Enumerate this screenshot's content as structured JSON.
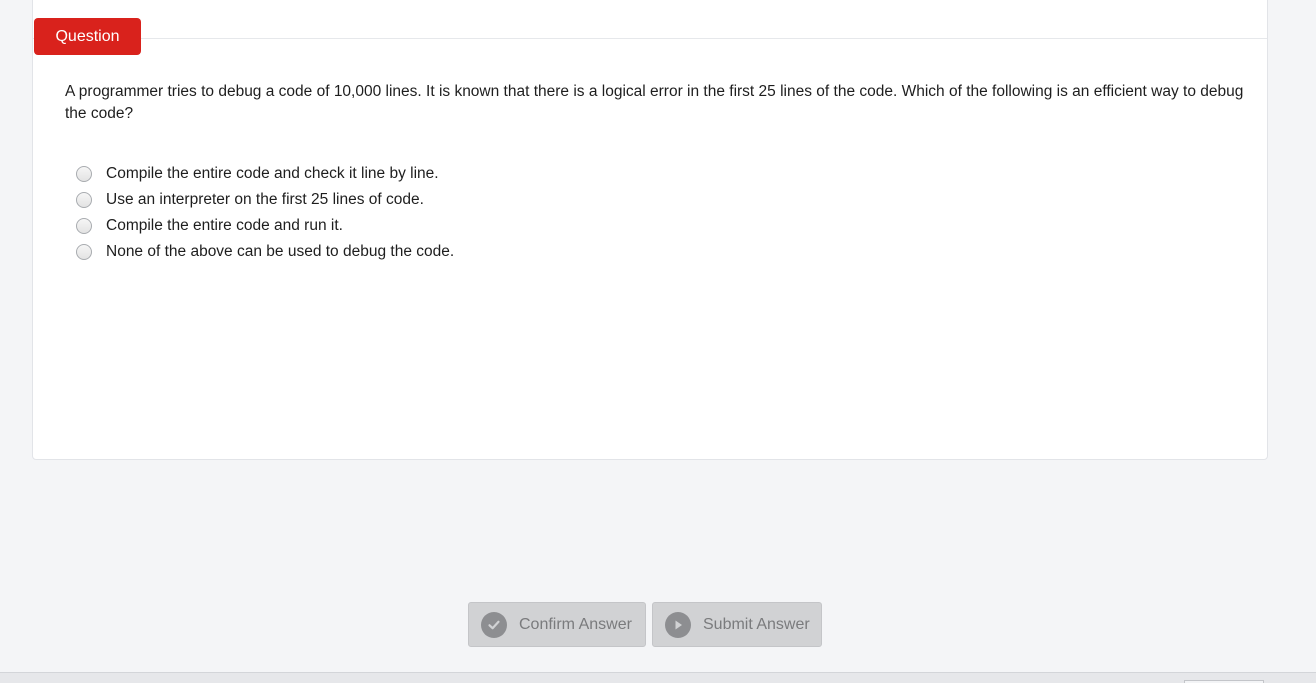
{
  "question": {
    "tag_label": "Question",
    "text": "A programmer tries to debug a code of 10,000 lines. It is known that there is a logical error in the first 25 lines of the code. Which of the following is an efficient way to debug the code?",
    "options": [
      "Compile the entire code and check it line by line.",
      "Use an interpreter on the first 25 lines of code.",
      "Compile the entire code and run it.",
      "None of the above can be used to debug the code."
    ]
  },
  "actions": {
    "confirm_label": "Confirm Answer",
    "submit_label": "Submit Answer",
    "confirm_icon": "check-circle-icon",
    "submit_icon": "play-circle-icon"
  },
  "colors": {
    "accent": "#d9221c",
    "button_disabled_bg": "#d1d2d4",
    "button_disabled_text": "#7a7b7d"
  }
}
